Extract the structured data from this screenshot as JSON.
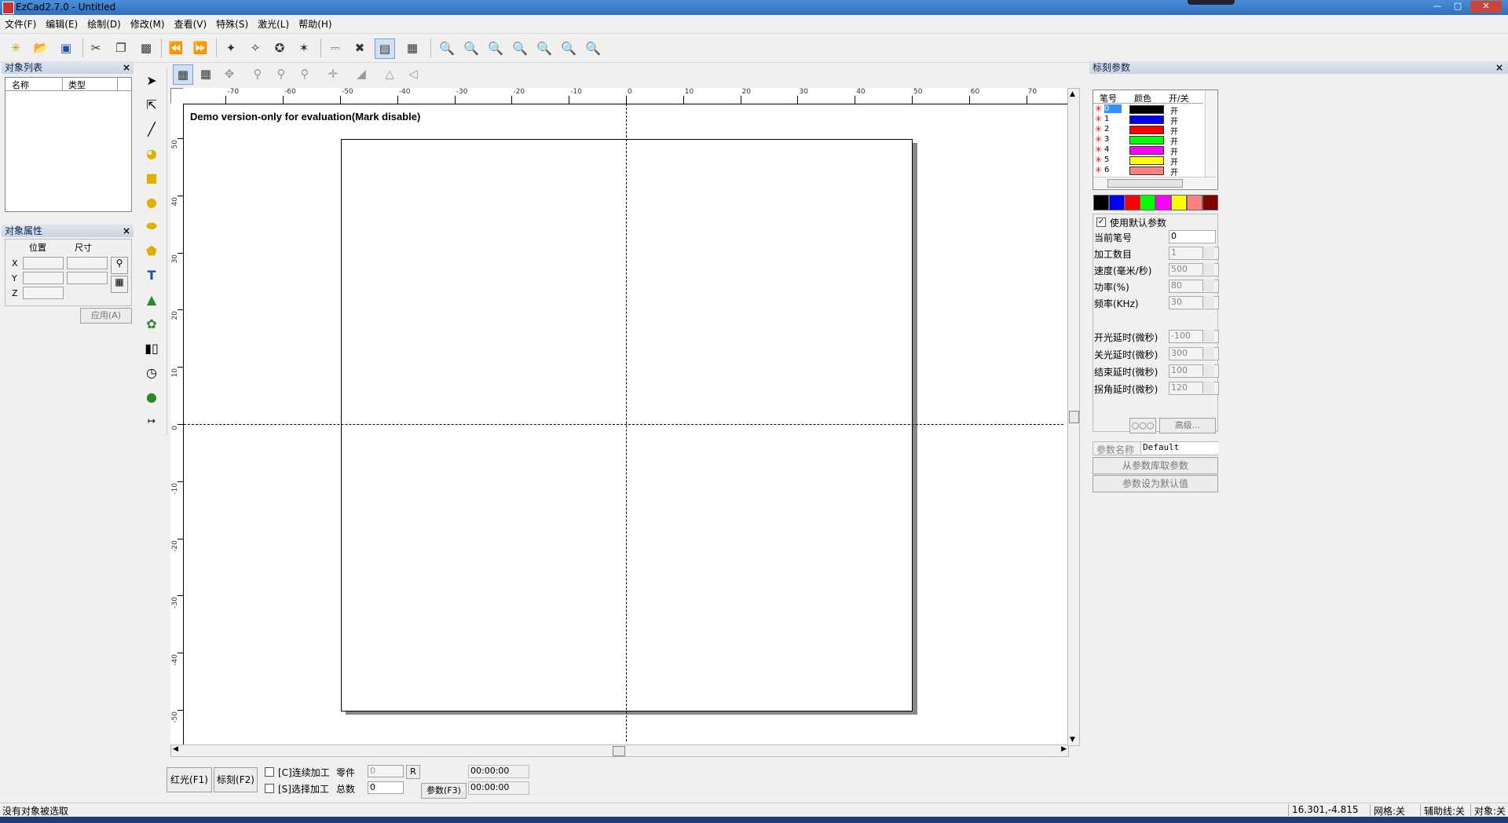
{
  "window": {
    "title": "EzCad2.7.0 - Untitled",
    "minimize": "0",
    "maximize": "1",
    "close": "r"
  },
  "menu": [
    "文件(F)",
    "编辑(E)",
    "绘制(D)",
    "修改(M)",
    "查看(V)",
    "特殊(S)",
    "激光(L)",
    "帮助(H)"
  ],
  "object_list": {
    "title": "对象列表",
    "col_name": "名称",
    "col_type": "类型"
  },
  "object_props": {
    "title": "对象属性",
    "pos": "位置",
    "size": "尺寸",
    "x": "X",
    "y": "Y",
    "z": "Z",
    "apply": "应用(A)"
  },
  "canvas": {
    "demo_text": "Demo version-only for evaluation(Mark disable)",
    "hticks": [
      "-70",
      "-60",
      "-50",
      "-40",
      "-30",
      "-20",
      "-10",
      "0",
      "10",
      "20",
      "30",
      "40",
      "50",
      "60",
      "70"
    ],
    "vticks": [
      "50",
      "40",
      "30",
      "20",
      "10",
      "0",
      "-10",
      "-20",
      "-30",
      "-40",
      "-50"
    ]
  },
  "mark_params": {
    "title": "标刻参数",
    "pen_headers": {
      "pen": "笔号",
      "color": "颜色",
      "onoff": "开/关"
    },
    "pens": [
      {
        "id": "0",
        "color": "#000000",
        "state": "开"
      },
      {
        "id": "1",
        "color": "#0000ff",
        "state": "开"
      },
      {
        "id": "2",
        "color": "#ff0000",
        "state": "开"
      },
      {
        "id": "3",
        "color": "#00ff00",
        "state": "开"
      },
      {
        "id": "4",
        "color": "#ff00ff",
        "state": "开"
      },
      {
        "id": "5",
        "color": "#ffff00",
        "state": "开"
      },
      {
        "id": "6",
        "color": "#ff8080",
        "state": "开"
      }
    ],
    "swatches": [
      "#000000",
      "#0000ff",
      "#ff0000",
      "#00ff00",
      "#ff00ff",
      "#ffff00",
      "#ff8080",
      "#800000"
    ],
    "use_default": "使用默认参数",
    "fields": [
      {
        "label": "当前笔号",
        "value": "0"
      },
      {
        "label": "加工数目",
        "value": "1"
      },
      {
        "label": "速度(毫米/秒)",
        "value": "500"
      },
      {
        "label": "功率(%)",
        "value": "80"
      },
      {
        "label": "频率(KHz)",
        "value": "30"
      }
    ],
    "delays": [
      {
        "label": "开光延时(微秒)",
        "value": "-100"
      },
      {
        "label": "关光延时(微秒)",
        "value": "300"
      },
      {
        "label": "结束延时(微秒)",
        "value": "100"
      },
      {
        "label": "拐角延时(微秒)",
        "value": "120"
      }
    ],
    "oo_btn": "○○○",
    "advanced": "高级...",
    "param_name_label": "参数名称",
    "param_name_value": "Default",
    "from_lib": "从参数库取参数",
    "set_default": "参数设为默认值"
  },
  "bottom": {
    "red_light": "红光(F1)",
    "mark": "标刻(F2)",
    "continuous": "[C]连续加工",
    "select": "[S]选择加工",
    "parts": "零件",
    "parts_value": "0",
    "r": "R",
    "total": "总数",
    "total_value": "0",
    "time1": "00:00:00",
    "time2": "00:00:00",
    "params": "参数(F3)"
  },
  "status": {
    "message": "没有对象被选取",
    "coords": "16.301,-4.815",
    "grid": "网格:关",
    "guides": "辅助线:关",
    "snap": "对象:关"
  }
}
